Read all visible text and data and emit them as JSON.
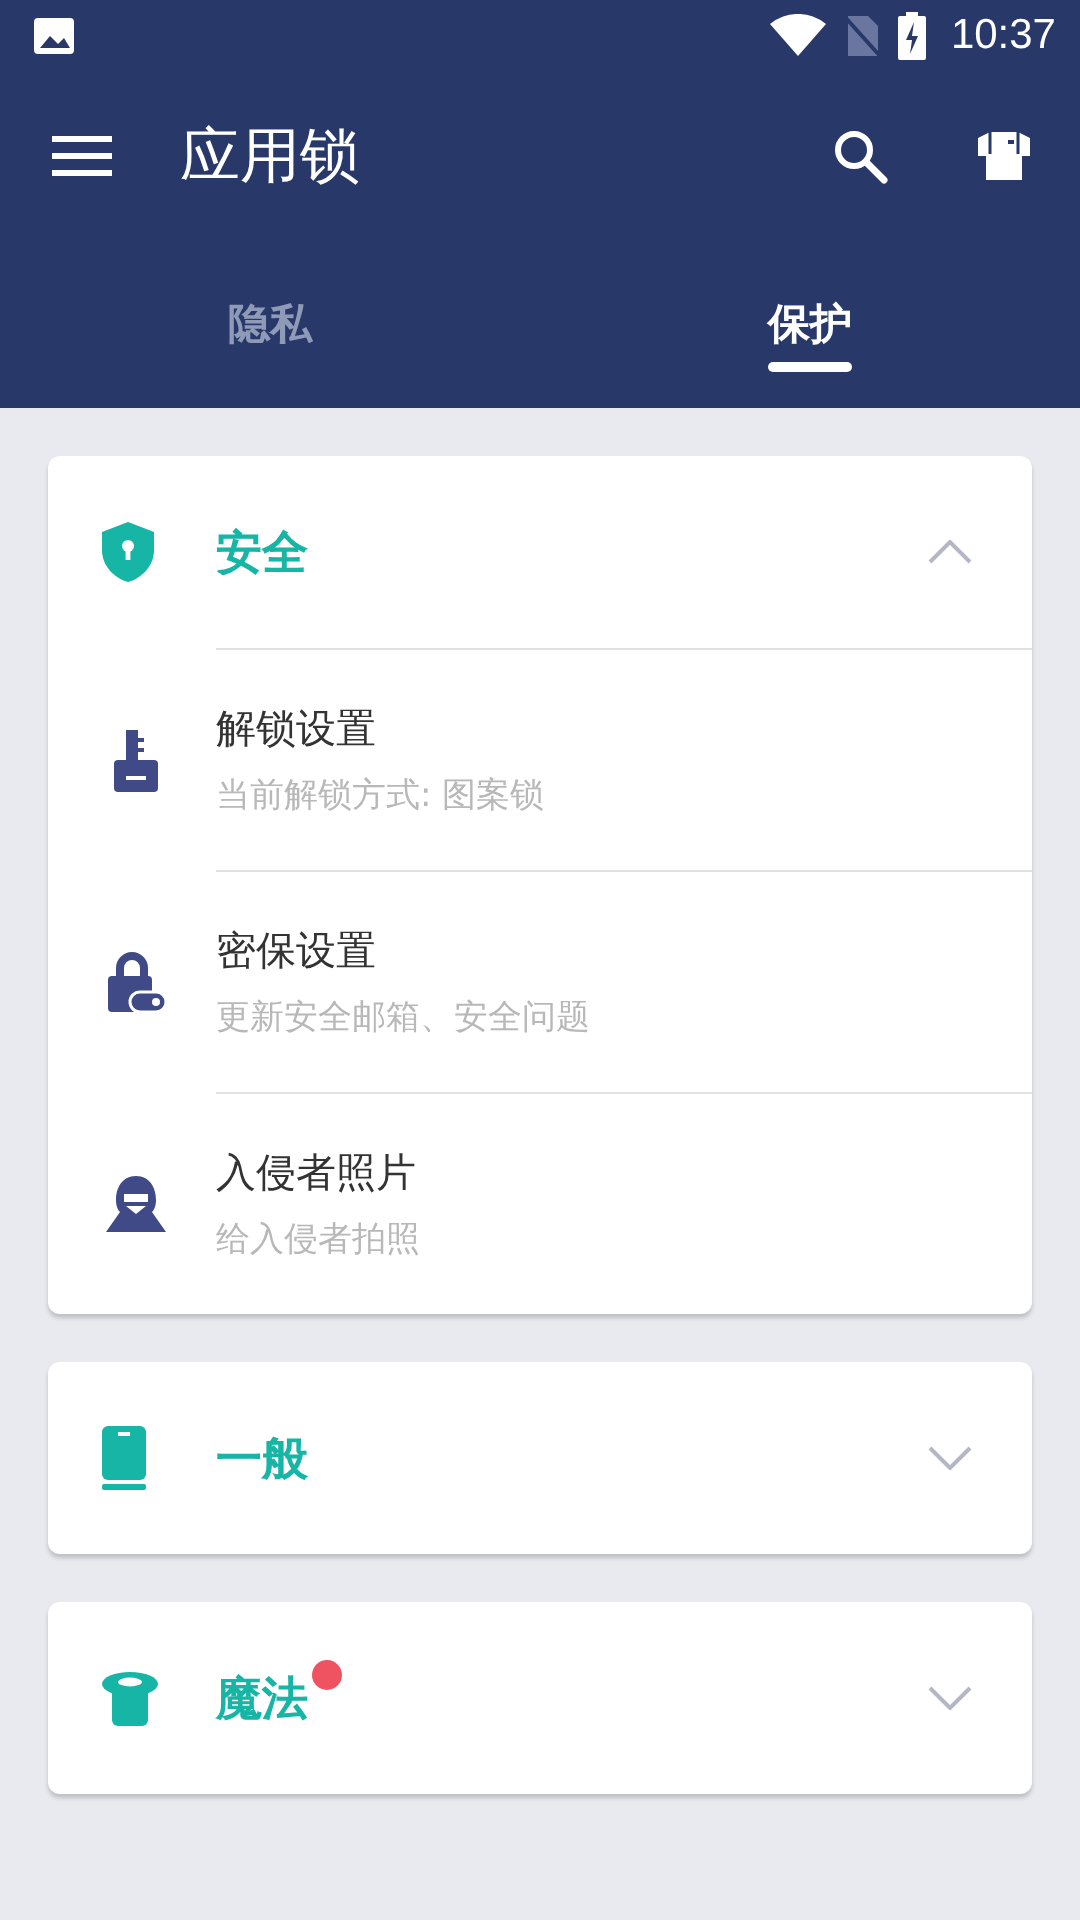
{
  "status_bar": {
    "time": "10:37"
  },
  "toolbar": {
    "title": "应用锁"
  },
  "tabs": [
    {
      "label": "隐私",
      "selected": false
    },
    {
      "label": "保护",
      "selected": true
    }
  ],
  "sections": [
    {
      "kind": "shield",
      "title": "安全",
      "expanded": true,
      "badge": false,
      "items": [
        {
          "kind": "key",
          "title": "解锁设置",
          "subtitle": "当前解锁方式: 图案锁"
        },
        {
          "kind": "padlock",
          "title": "密保设置",
          "subtitle": "更新安全邮箱、安全问题"
        },
        {
          "kind": "intruder",
          "title": "入侵者照片",
          "subtitle": "给入侵者拍照"
        }
      ]
    },
    {
      "kind": "phone",
      "title": "一般",
      "expanded": false,
      "badge": false
    },
    {
      "kind": "hat",
      "title": "魔法",
      "expanded": false,
      "badge": true
    }
  ]
}
